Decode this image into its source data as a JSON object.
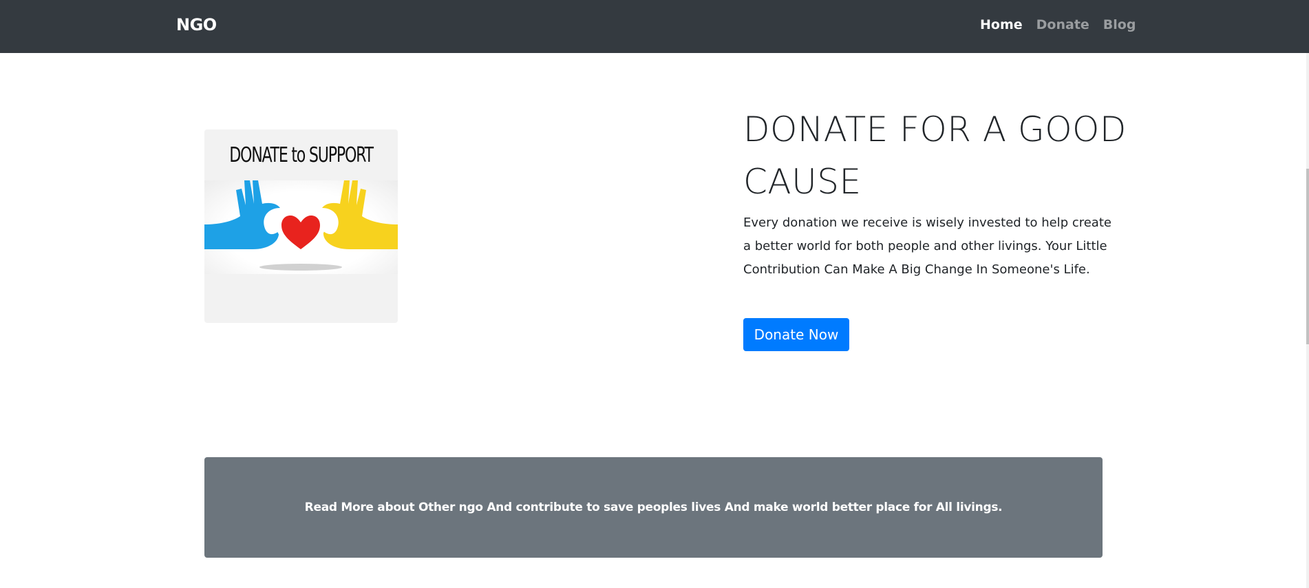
{
  "navbar": {
    "brand": "NGO",
    "links": [
      {
        "label": "Home",
        "active": true
      },
      {
        "label": "Donate",
        "active": false
      },
      {
        "label": "Blog",
        "active": false
      }
    ]
  },
  "hero": {
    "image_text": "DONATE to SUPPORT",
    "headline": "DONATE FOR A GOOD CAUSE",
    "description": "Every donation we receive is wisely invested to help create a better world for both people and other livings. Your Little Contribution Can Make A Big Change In Someone's Life.",
    "button_label": "Donate Now"
  },
  "banner": {
    "text": "Read More about Other ngo And contribute to save peoples lives And make world better place for All livings."
  },
  "colors": {
    "navbar_bg": "#343a40",
    "primary": "#007bff",
    "banner_bg": "#6c757d",
    "hand_left": "#1ea1e6",
    "hand_right": "#f7d21e",
    "heart": "#e8231e"
  }
}
